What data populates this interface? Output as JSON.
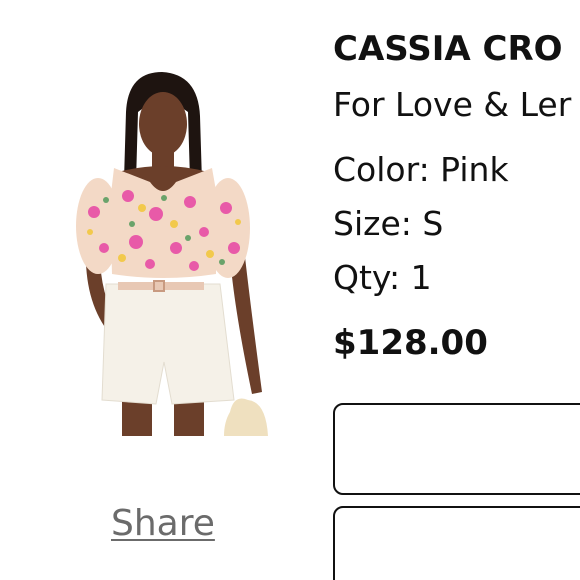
{
  "product": {
    "name": "CASSIA CRO",
    "brand": "For Love & Ler",
    "color": "Color: Pink",
    "size": "Size: S",
    "qty": "Qty: 1",
    "price": "$128.00"
  },
  "share": {
    "label": "Share"
  },
  "image": {
    "alt": "product-photo"
  }
}
